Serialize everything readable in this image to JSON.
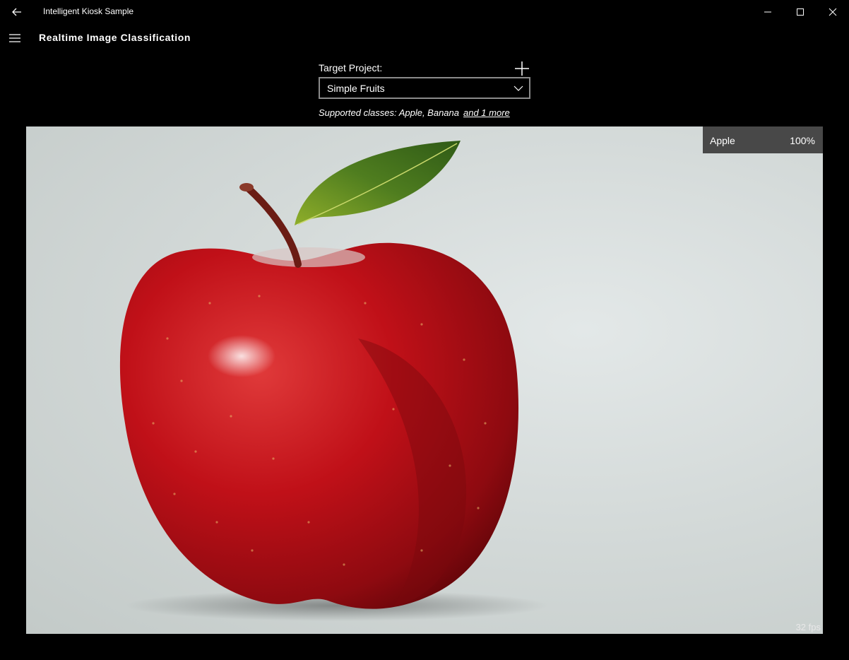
{
  "window": {
    "title": "Intelligent Kiosk Sample"
  },
  "header": {
    "page_title": "Realtime Image Classification"
  },
  "project": {
    "label": "Target Project:",
    "selected": "Simple Fruits",
    "supported_prefix": "Supported classes: Apple, Banana",
    "more_link": "and 1 more"
  },
  "camera": {
    "prediction_label": "Apple",
    "prediction_score": "100%",
    "fps": "32 fps"
  },
  "icons": {
    "back": "back-arrow-icon",
    "minimize": "minimize-icon",
    "maximize": "maximize-icon",
    "close": "close-icon",
    "menu": "hamburger-icon",
    "add": "plus-icon",
    "dropdown": "chevron-down-icon"
  },
  "colors": {
    "background": "#000000",
    "badge": "#3c3c3c",
    "apple_red": "#c8141c"
  }
}
